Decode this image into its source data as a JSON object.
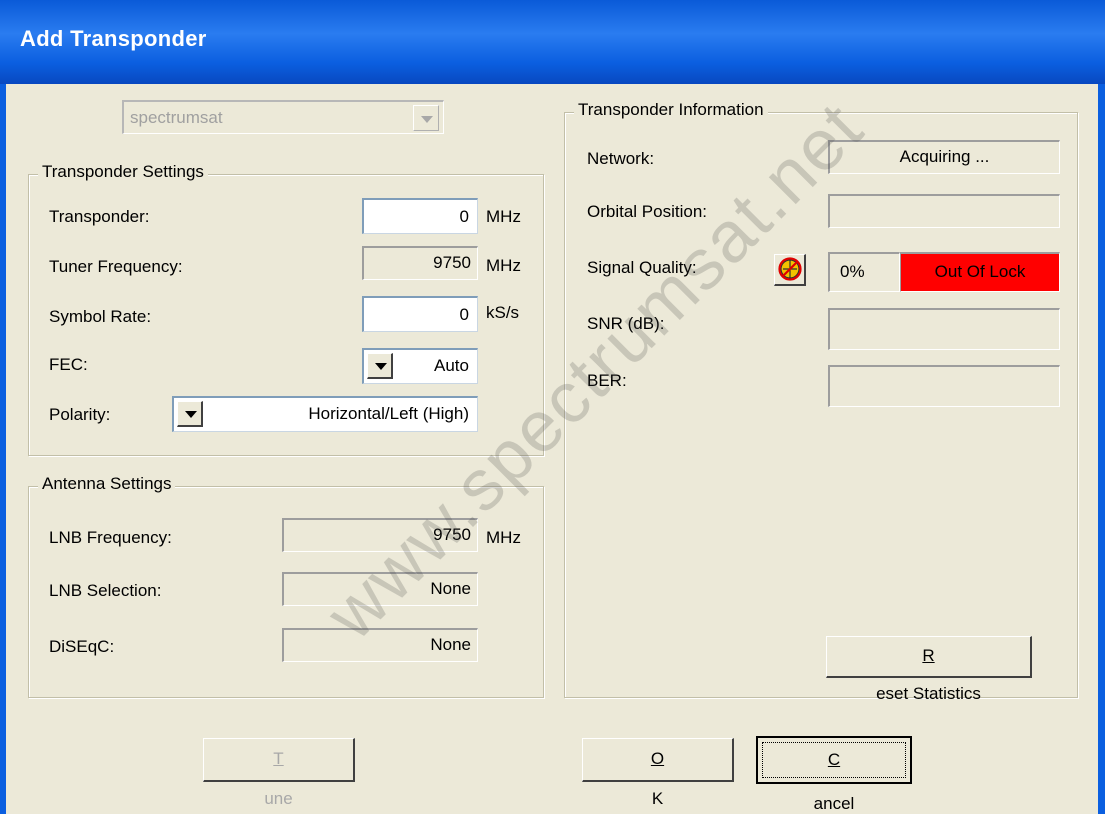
{
  "window": {
    "title": "Add Transponder"
  },
  "satellite_combo": {
    "value": "spectrumsat"
  },
  "transponder_settings": {
    "legend": "Transponder Settings",
    "transponder_label": "Transponder:",
    "transponder_value": "0",
    "transponder_unit": "MHz",
    "tuner_freq_label": "Tuner Frequency:",
    "tuner_freq_value": "9750",
    "tuner_freq_unit": "MHz",
    "symbol_rate_label": "Symbol Rate:",
    "symbol_rate_value": "0",
    "symbol_rate_unit": "kS/s",
    "fec_label": "FEC:",
    "fec_value": "Auto",
    "polarity_label": "Polarity:",
    "polarity_value": "Horizontal/Left (High)"
  },
  "antenna_settings": {
    "legend": "Antenna Settings",
    "lnb_freq_label": "LNB Frequency:",
    "lnb_freq_value": "9750",
    "lnb_freq_unit": "MHz",
    "lnb_sel_label": "LNB Selection:",
    "lnb_sel_value": "None",
    "diseqc_label": "DiSEqC:",
    "diseqc_value": "None"
  },
  "transponder_info": {
    "legend": "Transponder Information",
    "network_label": "Network:",
    "network_value": "Acquiring ...",
    "orbital_label": "Orbital Position:",
    "orbital_value": "",
    "signal_label": "Signal Quality:",
    "signal_percent": "0%",
    "signal_status": "Out Of Lock",
    "snr_label": "SNR (dB):",
    "snr_value": "",
    "ber_label": "BER:",
    "ber_value": "",
    "reset_prefix": "R",
    "reset_rest": "eset Statistics"
  },
  "buttons": {
    "tune_prefix": "T",
    "tune_rest": "une",
    "ok_prefix": "O",
    "ok_rest": "K",
    "cancel_prefix": "C",
    "cancel_rest": "ancel"
  },
  "watermark": "www.spectrumsat.net",
  "colors": {
    "title_bar": "#0b5fe0",
    "dialog_bg": "#ece9d8",
    "lock_status": "#ff0000"
  }
}
